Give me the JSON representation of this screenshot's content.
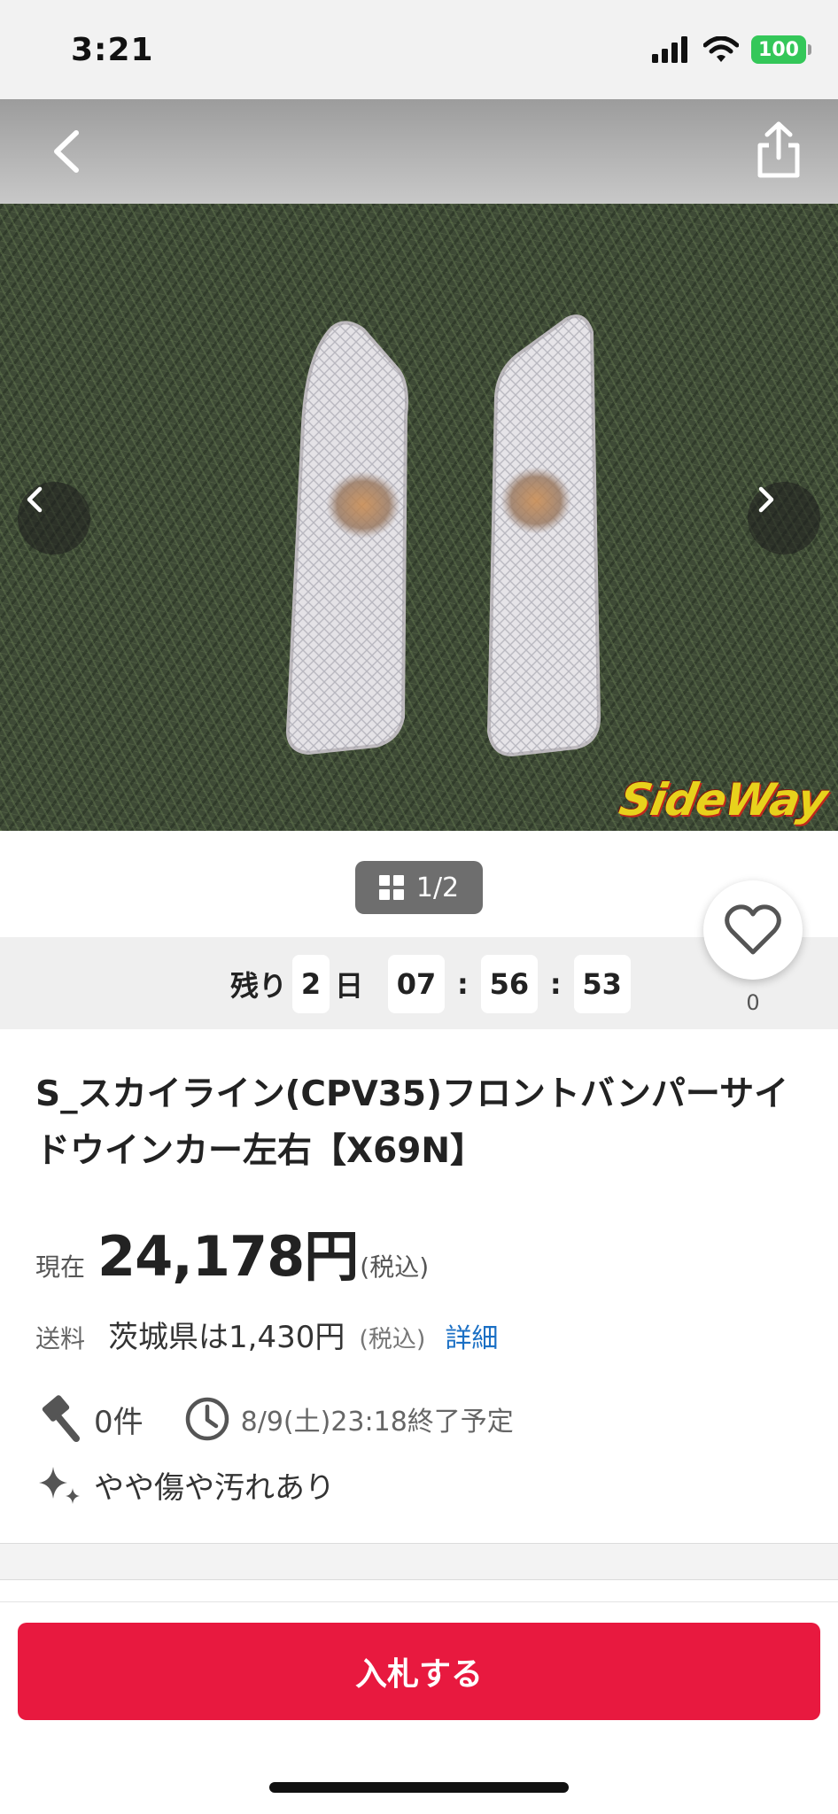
{
  "status_bar": {
    "time": "3:21",
    "battery": "100"
  },
  "gallery": {
    "counter": "1/2",
    "watermark": "SideWay"
  },
  "timer": {
    "prefix": "残り",
    "days": "2",
    "day_unit": "日",
    "hours": "07",
    "minutes": "56",
    "seconds": "53",
    "separator": ":"
  },
  "favorite": {
    "count": "0"
  },
  "item": {
    "title": "S_スカイライン(CPV35)フロントバンパーサイドウインカー左右【X69N】"
  },
  "price": {
    "label": "現在",
    "value": "24,178円",
    "tax": "(税込)"
  },
  "shipping": {
    "label": "送料",
    "value": "茨城県は1,430円",
    "tax": "(税込)",
    "detail_link": "詳細"
  },
  "bids": {
    "count": "0件",
    "end_time": "8/9(土)23:18終了予定"
  },
  "condition": {
    "text": "やや傷や汚れあり"
  },
  "action": {
    "bid_button": "入札する"
  },
  "colors": {
    "accent": "#e8193f",
    "link": "#1a6fc4",
    "battery": "#34c759"
  }
}
